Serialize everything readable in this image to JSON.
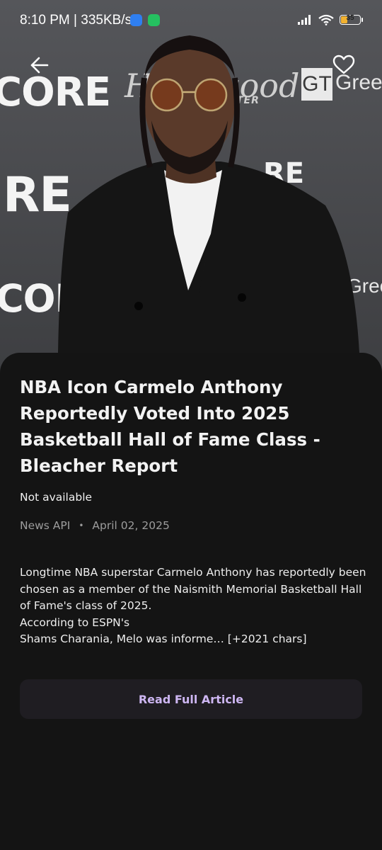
{
  "status_bar": {
    "time_speed": "8:10 PM | 335KB/s",
    "battery_level": "35",
    "battery_fraction": 0.35,
    "icons": [
      "messages-app-icon",
      "whatsapp-icon",
      "signal-icon",
      "wifi-icon",
      "battery-icon"
    ]
  },
  "hero": {
    "backdrop_texts": {
      "core_1": "CORE",
      "re_2": "RE",
      "co_3": "COR",
      "hollywood": "Hollywood",
      "hollywood_sub": "TER",
      "gt": "GT",
      "green_1": "Green",
      "green_2": "Gree",
      "re_mid": "RE"
    },
    "colors": {
      "backdrop": "#4a4a4c",
      "suit": "#151515",
      "shirt": "#f2f2f2",
      "skin": "#5a3a2a"
    }
  },
  "toolbar": {
    "back_icon": "arrow-left-icon",
    "favorite_icon": "heart-outline-icon"
  },
  "article": {
    "title": "NBA Icon Carmelo Anthony Reportedly Voted Into 2025 Basketball Hall of Fame Class - Bleacher Report",
    "title_lines": [
      "NBA Icon Carmelo Anthony",
      "Reportedly Voted Into 2025",
      "Basketball Hall of Fame Class -",
      "Bleacher Report"
    ],
    "author": "Not available",
    "source": "News API",
    "separator": "•",
    "date": "April 02, 2025",
    "description_lines": [
      "Longtime NBA superstar Carmelo Anthony has reportedly been",
      "chosen as a member of the Naismith Memorial Basketball Hall",
      "of Fame's class of 2025.",
      "According to ESPN's",
      "Shams Charania, Melo was informe… [+2021 chars]"
    ],
    "read_button_label": "Read Full Article"
  },
  "colors": {
    "background": "#141414",
    "accent": "#cdb6f2",
    "button_bg": "#1f1d22",
    "muted_text": "#9c9c9c"
  }
}
